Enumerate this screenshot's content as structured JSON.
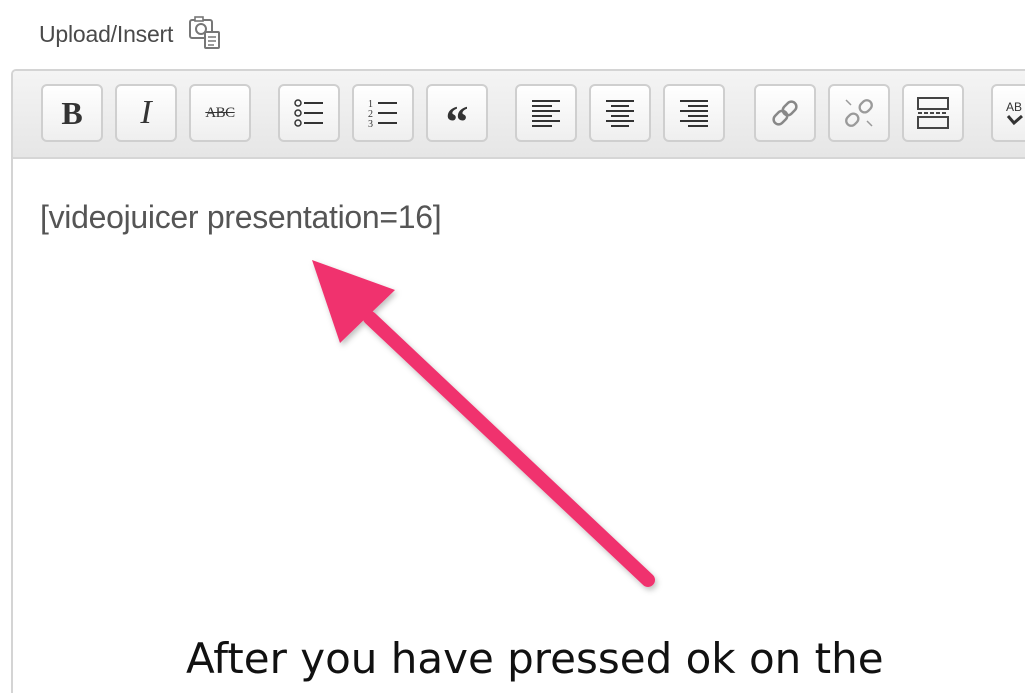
{
  "upload": {
    "label": "Upload/Insert",
    "icon": "media-upload-icon"
  },
  "toolbar": {
    "buttons": [
      {
        "name": "bold",
        "glyph": "B",
        "icon": "bold-icon"
      },
      {
        "name": "italic",
        "glyph": "I",
        "icon": "italic-icon"
      },
      {
        "name": "strikethrough",
        "glyph": "ABC",
        "icon": "strikethrough-icon"
      },
      {
        "name": "bulleted-list",
        "icon": "bullet-list-icon"
      },
      {
        "name": "numbered-list",
        "icon": "numbered-list-icon"
      },
      {
        "name": "blockquote",
        "glyph": "“",
        "icon": "blockquote-icon"
      },
      {
        "name": "align-left",
        "icon": "align-left-icon"
      },
      {
        "name": "align-center",
        "icon": "align-center-icon"
      },
      {
        "name": "align-right",
        "icon": "align-right-icon"
      },
      {
        "name": "insert-link",
        "icon": "link-icon"
      },
      {
        "name": "remove-link",
        "icon": "unlink-icon"
      },
      {
        "name": "insert-more",
        "icon": "more-tag-icon"
      },
      {
        "name": "spellcheck",
        "glyph": "AB",
        "icon": "spellcheck-icon"
      }
    ]
  },
  "editor": {
    "content": "[videojuicer presentation=16]"
  },
  "annotation": {
    "arrow_color": "#f0336e"
  },
  "caption": {
    "text": "After you have pressed ok on the"
  },
  "colors": {
    "toolbar_bg": "#ececec",
    "button_border": "#cfcfcf",
    "editor_border": "#d4d4d4",
    "content_text": "#555555"
  }
}
